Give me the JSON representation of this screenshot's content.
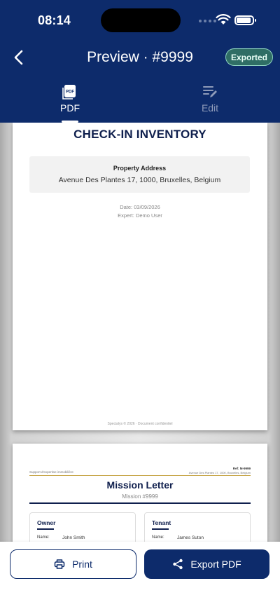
{
  "status_bar": {
    "time": "08:14"
  },
  "header": {
    "title": "Preview · #9999",
    "badge": "Exported",
    "tabs": [
      {
        "label": "PDF",
        "icon": "pdf-icon",
        "active": true
      },
      {
        "label": "Edit",
        "icon": "edit-icon",
        "active": false
      }
    ]
  },
  "page1": {
    "title": "CHECK-IN INVENTORY",
    "address_label": "Property Address",
    "address": "Avenue Des Plantes 17, 1000, Bruxelles, Belgium",
    "date": "Date: 03/09/2026",
    "expert": "Expert: Demo User",
    "footer": "Specialys © 2026 · Document confidentiel"
  },
  "page2": {
    "left_header": "Support d'expertise immobilière",
    "ref": "Ref: M-9999",
    "ref_address": "Avenue Des Plantes 17, 1000, Bruxelles, Belgium",
    "title": "Mission Letter",
    "subtitle": "Mission #9999",
    "owner": {
      "title": "Owner",
      "name_label": "Name:",
      "name": "John Smith"
    },
    "tenant": {
      "title": "Tenant",
      "name_label": "Name:",
      "name": "James Suton"
    }
  },
  "actions": {
    "print_label": "Print",
    "export_label": "Export PDF"
  },
  "colors": {
    "header_bg": "#0d2b6b",
    "badge_bg": "#2f6e65",
    "badge_border": "#8fd4c0",
    "doc_title": "#0f1f4d",
    "gold_rule": "#c9a94e"
  }
}
